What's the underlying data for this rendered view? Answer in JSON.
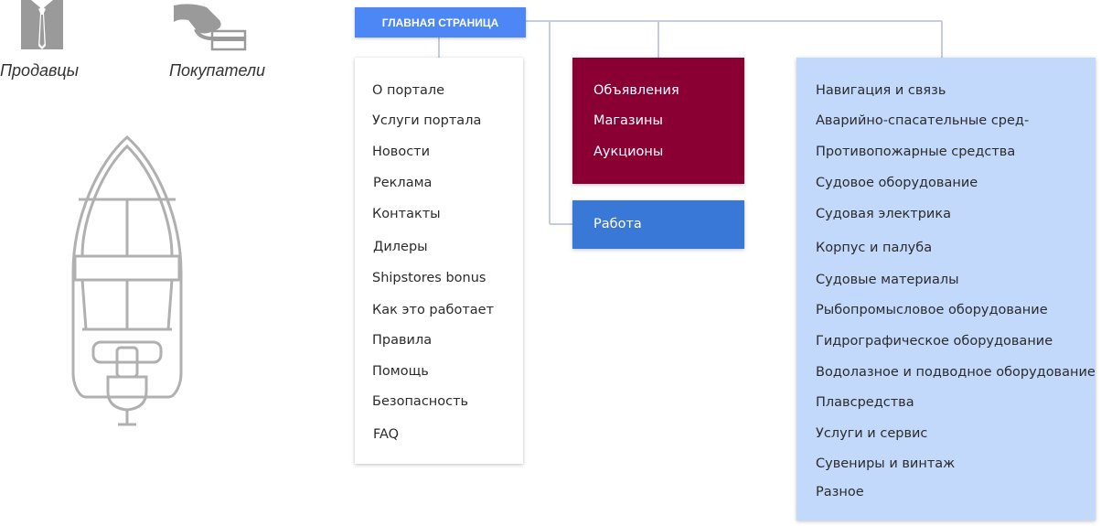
{
  "roles": [
    {
      "label": "Продавцы",
      "icon": "seller-shirt-icon"
    },
    {
      "label": "Покупатели",
      "icon": "buyer-card-hand-icon"
    }
  ],
  "boat_icon": "boat-top-view-icon",
  "root": {
    "label": "ГЛАВНАЯ СТРАНИЦА",
    "color": "#4d86f5"
  },
  "portal_menu": {
    "items": [
      "О портале",
      "Услуги портала",
      "Новости",
      "Реклама",
      "Контакты",
      "Дилеры",
      "Shipstores bonus",
      "Как это работает",
      "Правила",
      "Помощь",
      "Безопасность",
      "FAQ"
    ]
  },
  "market_menu": {
    "color": "#8b0033",
    "items": [
      "Объявления",
      "Магазины",
      "Аукционы"
    ]
  },
  "jobs_menu": {
    "color": "#3a78d8",
    "items": [
      "Работа"
    ]
  },
  "catalog_menu": {
    "color": "#c3d9fc",
    "items": [
      "Навигация и связь",
      "Аварийно-спасательные сред-",
      "Противопожарные средства",
      "Судовое оборудование",
      "Судовая электрика",
      "Корпус и палуба",
      "Судовые материалы",
      "Рыбопромысловое оборудование",
      "Гидрографическое оборудование",
      "Водолазное и подводное оборудование",
      "Плавсредства",
      "Услуги и сервис",
      "Сувениры и винтаж",
      "Разное"
    ]
  }
}
